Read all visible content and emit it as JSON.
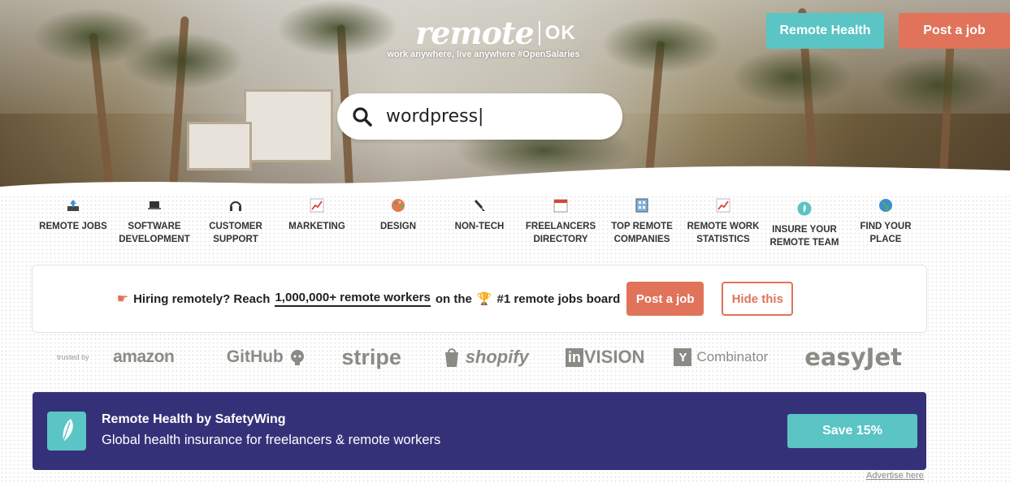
{
  "header": {
    "logo_word": "remote",
    "logo_suffix": "OK",
    "tagline": "work anywhere, live anywhere #OpenSalaries",
    "remote_health_label": "Remote Health",
    "post_job_label": "Post a job"
  },
  "search": {
    "value": "wordpress|",
    "icon": "search-icon"
  },
  "nav": {
    "items": [
      {
        "label_line1": "REMOTE JOBS",
        "label_line2": "",
        "icon": "upload-tray-icon"
      },
      {
        "label_line1": "SOFTWARE",
        "label_line2": "DEVELOPMENT",
        "icon": "laptop-icon"
      },
      {
        "label_line1": "CUSTOMER",
        "label_line2": "SUPPORT",
        "icon": "headphones-icon"
      },
      {
        "label_line1": "MARKETING",
        "label_line2": "",
        "icon": "chart-icon"
      },
      {
        "label_line1": "DESIGN",
        "label_line2": "",
        "icon": "palette-icon"
      },
      {
        "label_line1": "NON-TECH",
        "label_line2": "",
        "icon": "brush-icon"
      },
      {
        "label_line1": "FREELANCERS",
        "label_line2": "DIRECTORY",
        "icon": "calendar-icon"
      },
      {
        "label_line1": "TOP REMOTE",
        "label_line2": "COMPANIES",
        "icon": "building-icon"
      },
      {
        "label_line1": "REMOTE WORK",
        "label_line2": "STATISTICS",
        "icon": "chart-icon"
      },
      {
        "label_line1": "INSURE YOUR",
        "label_line2": "REMOTE TEAM",
        "icon": "feather-icon"
      },
      {
        "label_line1": "FIND YOUR",
        "label_line2": "PLACE",
        "icon": "globe-icon"
      }
    ]
  },
  "hiring_banner": {
    "text_before": "Hiring remotely? Reach",
    "link_text": "1,000,000+ remote workers",
    "text_middle": "on the",
    "text_after": "#1 remote jobs board",
    "post_job_label": "Post a job",
    "hide_label": "Hide this"
  },
  "trusted": {
    "label": "trusted by",
    "logos": [
      "amazon",
      "GitHub",
      "stripe",
      "shopify",
      "in",
      "VISION",
      "Y",
      "Combinator",
      "easyJet"
    ]
  },
  "ad": {
    "title": "Remote Health by SafetyWing",
    "description": "Global health insurance for freelancers & remote workers",
    "button_label": "Save 15%",
    "advertise_label": "Advertise here"
  },
  "colors": {
    "teal": "#5bc4c4",
    "coral": "#e0735a",
    "ad_bg": "#353179"
  }
}
